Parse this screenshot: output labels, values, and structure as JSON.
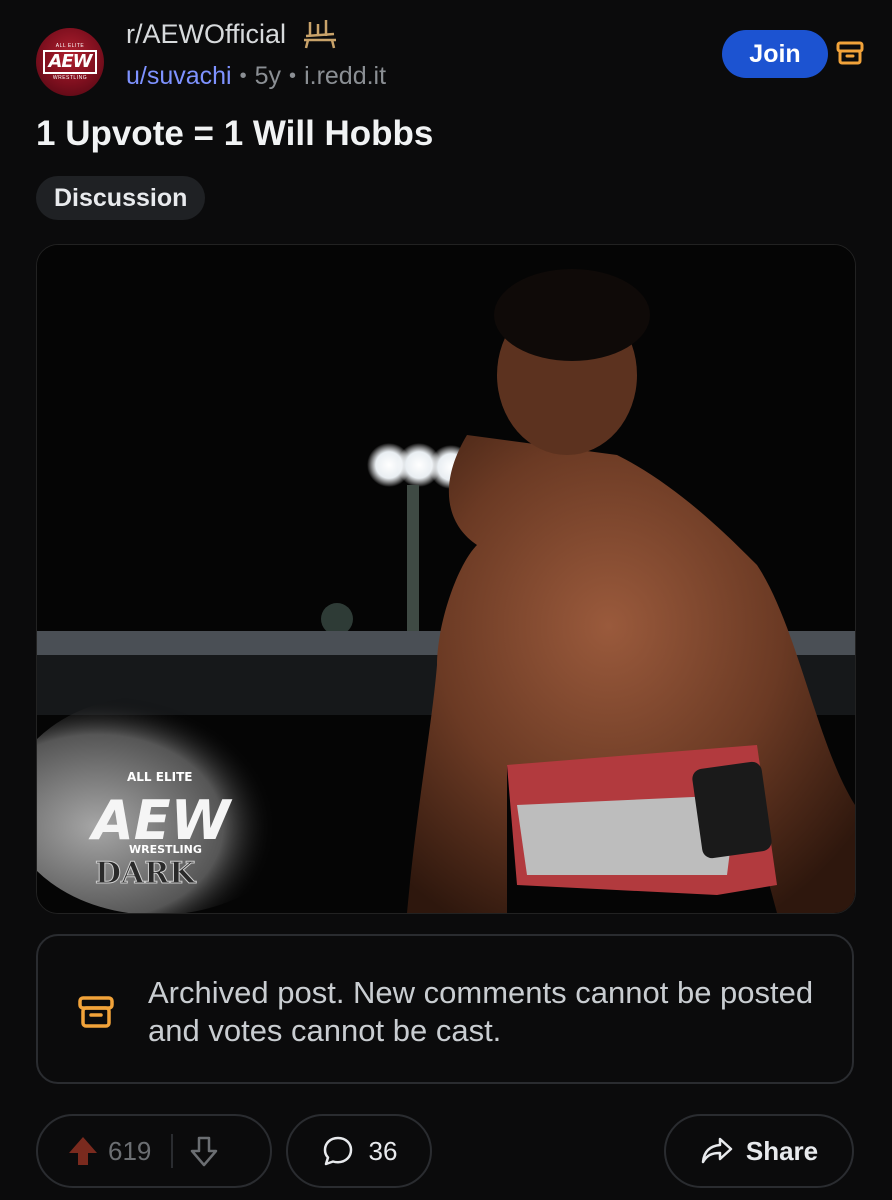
{
  "header": {
    "subreddit": "r/AEWOfficial",
    "user": "u/suvachi",
    "age": "5y",
    "domain": "i.redd.it",
    "dot": "•",
    "join_label": "Join",
    "avatar_top": "ALL ELITE",
    "avatar_logo": "AEW",
    "avatar_bottom": "WRESTLING",
    "icons": [
      "aew-avatar-icon",
      "flair-chair-icon",
      "archive-icon"
    ]
  },
  "post": {
    "title": "1 Upvote = 1 Will Hobbs",
    "flair": "Discussion"
  },
  "image": {
    "watermark_top": "ALL ELITE",
    "watermark_logo": "AEW",
    "watermark_sub": "WRESTLING",
    "watermark_show": "DARK"
  },
  "archived": {
    "message": "Archived post. New comments cannot be posted and votes cannot be cast."
  },
  "actions": {
    "upvotes": "619",
    "comments": "36",
    "share_label": "Share"
  },
  "colors": {
    "accent": "#1c53d1",
    "upvote": "#7a2a1e",
    "username": "#7e92ff",
    "archive_icon": "#f2a33a"
  }
}
